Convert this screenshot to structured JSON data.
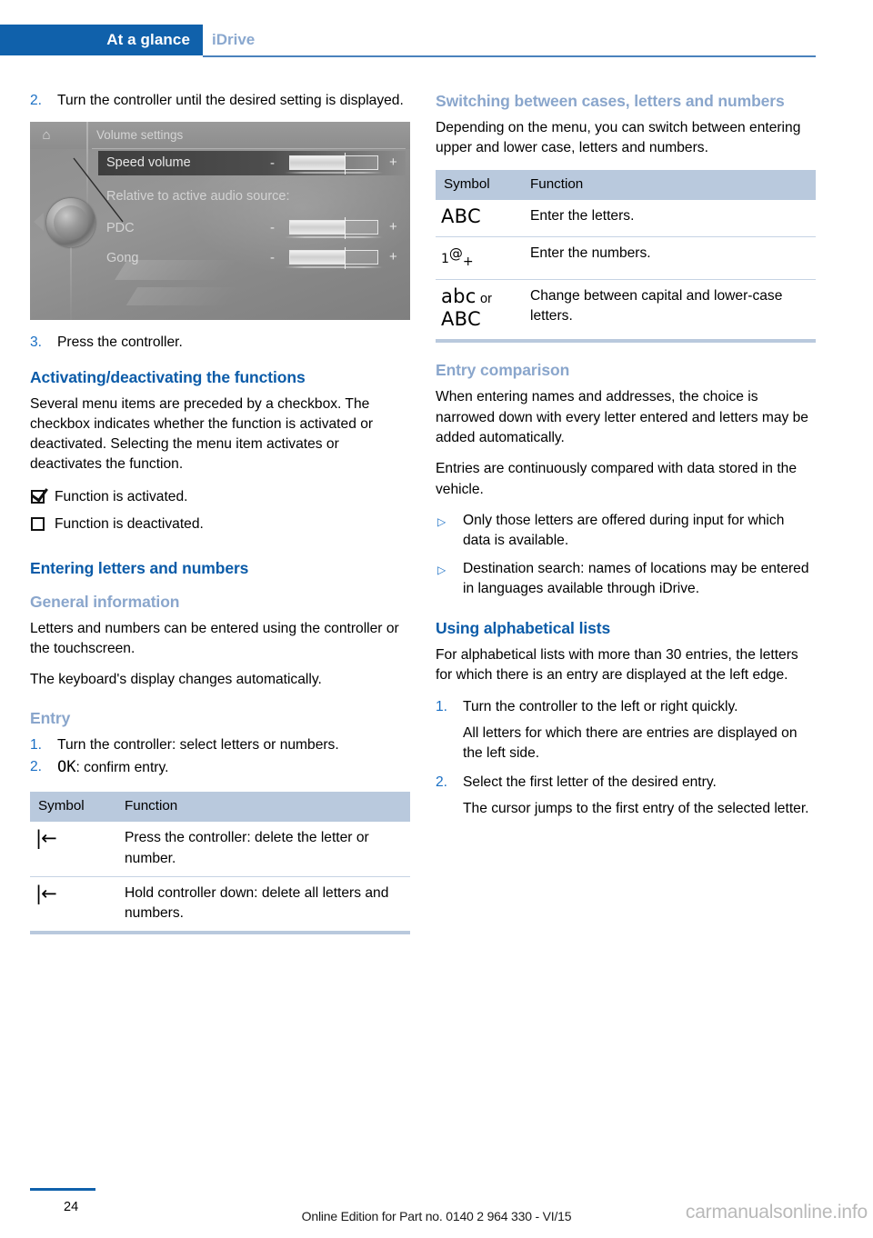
{
  "header": {
    "active_tab": "At a glance",
    "inactive_tab": "iDrive"
  },
  "left_column": {
    "step2": {
      "num": "2.",
      "text": "Turn the controller until the desired setting is displayed."
    },
    "idrive_screenshot": {
      "home_icon": "home-icon",
      "title": "Volume settings",
      "rows": [
        {
          "label": "Speed volume",
          "minus": "-",
          "plus": "+",
          "fill_percent": 62,
          "selected": true
        },
        {
          "label": "Relative to active audio source:",
          "is_caption": true
        },
        {
          "label": "PDC",
          "minus": "-",
          "plus": "+",
          "fill_percent": 62,
          "selected": false
        },
        {
          "label": "Gong",
          "minus": "-",
          "plus": "+",
          "fill_percent": 62,
          "selected": false
        }
      ]
    },
    "step3": {
      "num": "3.",
      "text": "Press the controller."
    },
    "activating_heading": "Activating/deactivating the functions",
    "activating_para": "Several menu items are preceded by a checkbox. The checkbox indicates whether the function is activated or deactivated. Selecting the menu item activates or deactivates the function.",
    "checkbox_lines": [
      {
        "state": "checked",
        "text": "Function is activated."
      },
      {
        "state": "unchecked",
        "text": "Function is deactivated."
      }
    ],
    "entering_heading": "Entering letters and numbers",
    "general_heading": "General information",
    "general_para1": "Letters and numbers can be entered using the controller or the touchscreen.",
    "general_para2": "The keyboard's display changes automatically.",
    "entry_heading": "Entry",
    "entry_steps": [
      {
        "num": "1.",
        "text": "Turn the controller: select letters or numbers."
      },
      {
        "num": "2.",
        "symbol": "OK",
        "text": ": confirm entry."
      }
    ],
    "table": {
      "headers": [
        "Symbol",
        "Function"
      ],
      "rows": [
        {
          "symbol": "|←",
          "function": "Press the controller: delete the letter or number."
        },
        {
          "symbol": "|←",
          "function": "Hold controller down: delete all letters and numbers."
        }
      ]
    }
  },
  "right_column": {
    "switching_heading": "Switching between cases, letters and numbers",
    "switching_para": "Depending on the menu, you can switch between entering upper and lower case, letters and numbers.",
    "table": {
      "headers": [
        "Symbol",
        "Function"
      ],
      "rows": [
        {
          "symbol": "ABC",
          "symbol_kind": "abc-upper",
          "function": "Enter the letters."
        },
        {
          "symbol": "1@+",
          "symbol_kind": "num-at-plus",
          "function": "Enter the numbers."
        },
        {
          "symbol": "abc or ABC",
          "symbol_kind": "abc-or-abc",
          "symbol_lower": "abc",
          "symbol_or": "or",
          "symbol_upper": "ABC",
          "function": "Change between capital and lower-case letters."
        }
      ]
    },
    "comparison_heading": "Entry comparison",
    "comparison_para1": "When entering names and addresses, the choice is narrowed down with every letter entered and letters may be added automatically.",
    "comparison_para2": "Entries are continuously compared with data stored in the vehicle.",
    "comparison_bullets": [
      "Only those letters are offered during input for which data is available.",
      "Destination search: names of locations may be entered in languages available through iDrive."
    ],
    "alpha_heading": "Using alphabetical lists",
    "alpha_para": "For alphabetical lists with more than 30 entries, the letters for which there is an entry are displayed at the left edge.",
    "alpha_steps": [
      {
        "num": "1.",
        "text": "Turn the controller to the left or right quickly.",
        "continuation": "All letters for which there are entries are displayed on the left side."
      },
      {
        "num": "2.",
        "text": "Select the first letter of the desired entry.",
        "continuation": "The cursor jumps to the first entry of the selected letter."
      }
    ]
  },
  "footer": {
    "page_number": "24",
    "edition": "Online Edition for Part no. 0140 2 964 330 - VI/15",
    "watermark": "carmanualsonline.info"
  },
  "colors": {
    "brand_blue": "#1061ab",
    "heading_blue": "#0b5ba8",
    "heading_light_blue": "#8aa6cc",
    "table_header": "#b9c9dd",
    "tab_inactive": "#8aa8cf"
  }
}
